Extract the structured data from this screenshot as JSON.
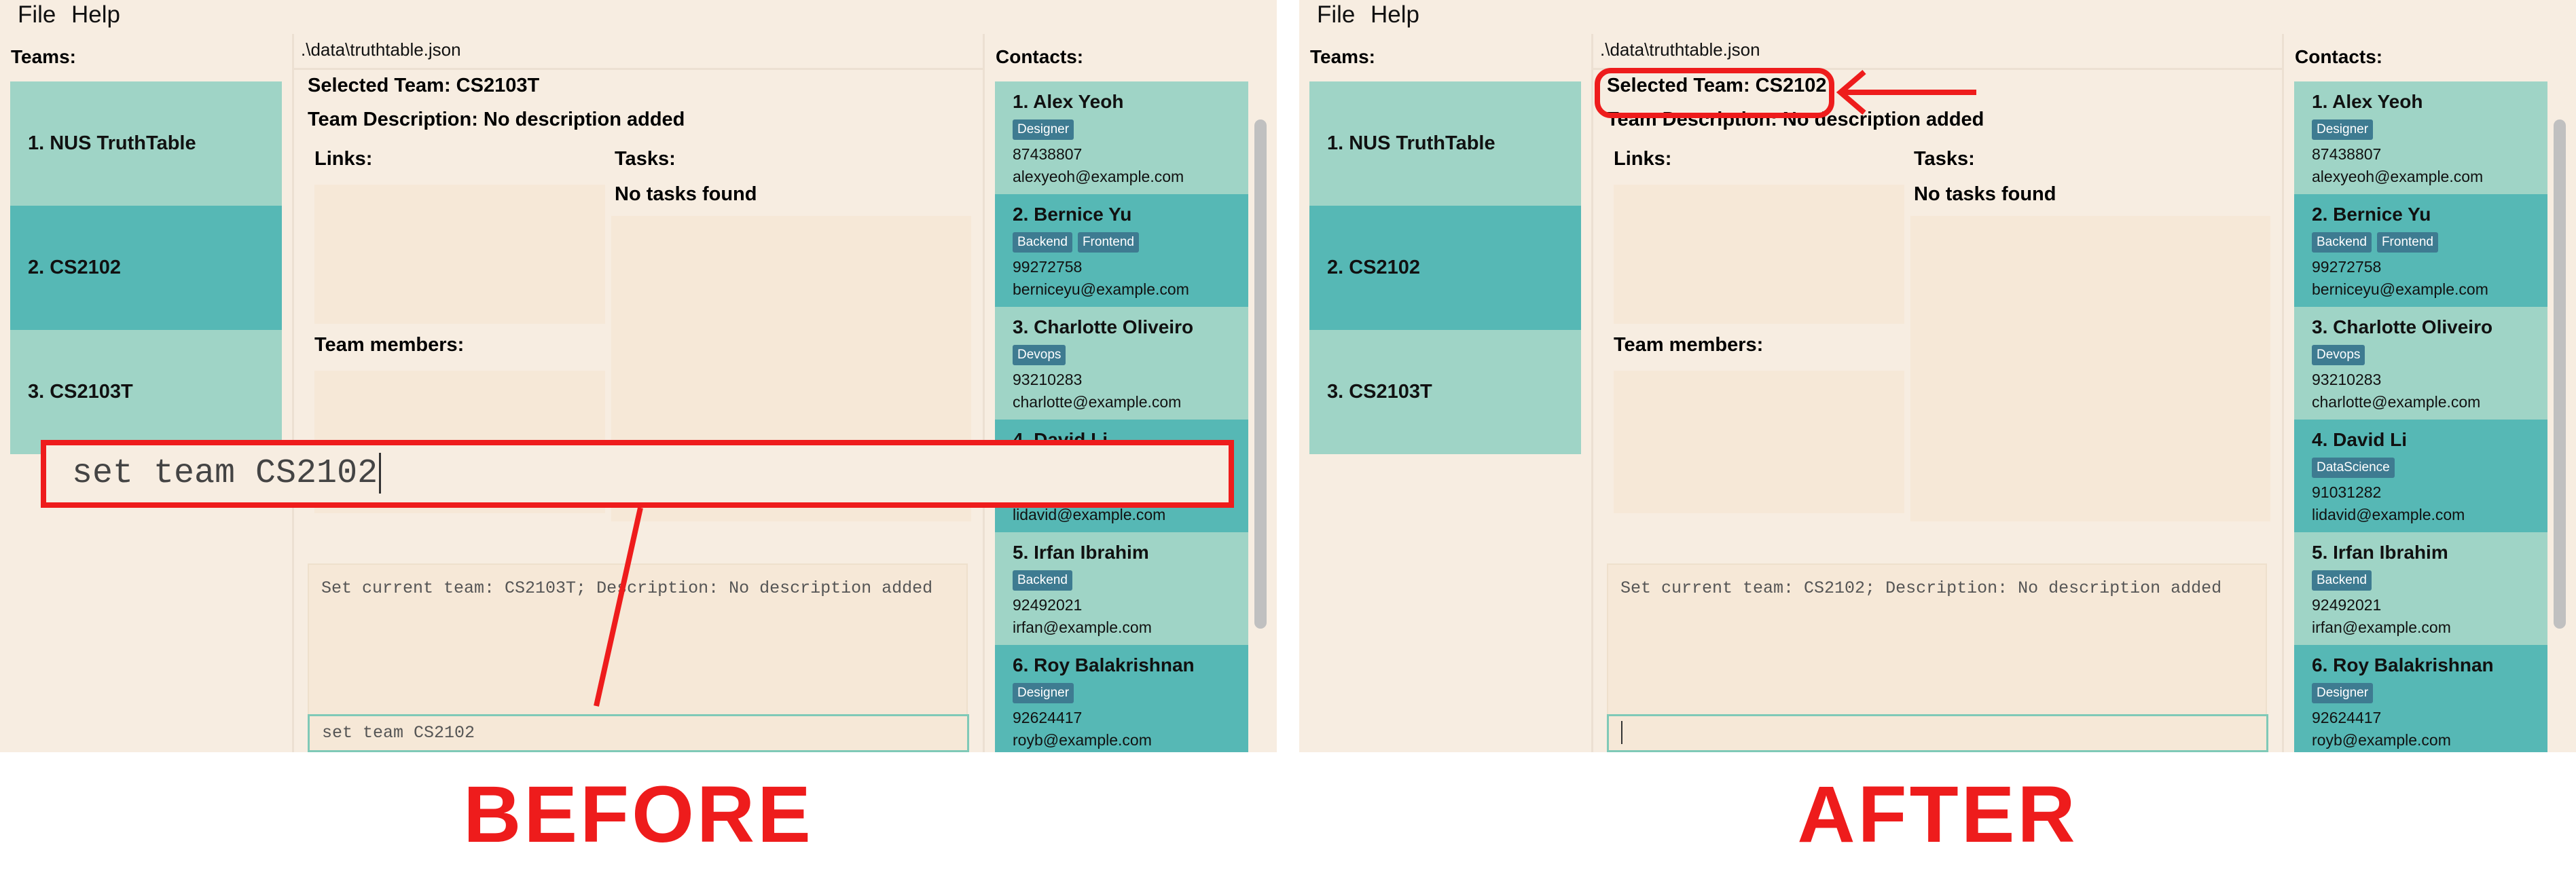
{
  "menu": {
    "file": "File",
    "help": "Help"
  },
  "labels": {
    "teams_title": "Teams:",
    "contacts_title": "Contacts:",
    "file_path": ".\\data\\truthtable.json",
    "links": "Links:",
    "tasks": "Tasks:",
    "team_members": "Team members:",
    "no_tasks": "No tasks found"
  },
  "teams": [
    {
      "label": "1. NUS TruthTable"
    },
    {
      "label": "2. CS2102"
    },
    {
      "label": "3. CS2103T"
    }
  ],
  "contacts": [
    {
      "name": "1. Alex Yeoh",
      "tags": [
        "Designer"
      ],
      "phone": "87438807",
      "email": "alexyeoh@example.com"
    },
    {
      "name": "2. Bernice Yu",
      "tags": [
        "Backend",
        "Frontend"
      ],
      "phone": "99272758",
      "email": "berniceyu@example.com"
    },
    {
      "name": "3. Charlotte Oliveiro",
      "tags": [
        "Devops"
      ],
      "phone": "93210283",
      "email": "charlotte@example.com"
    },
    {
      "name": "4. David Li",
      "tags": [
        "DataScience"
      ],
      "phone": "91031282",
      "email": "lidavid@example.com"
    },
    {
      "name": "5. Irfan Ibrahim",
      "tags": [
        "Backend"
      ],
      "phone": "92492021",
      "email": "irfan@example.com"
    },
    {
      "name": "6. Roy Balakrishnan",
      "tags": [
        "Designer"
      ],
      "phone": "92624417",
      "email": "royb@example.com"
    }
  ],
  "before": {
    "selected_team": "Selected Team: CS2103T",
    "team_description": "Team Description: No description added",
    "result": "Set current team: CS2103T; Description: No description added",
    "command": "set team CS2102"
  },
  "after": {
    "selected_team": "Selected Team: CS2102",
    "team_description": "Team Description: No description added",
    "result": "Set current team: CS2102; Description: No description added",
    "command": ""
  },
  "annotation": {
    "command_zoom": "set team CS2102",
    "before_caption": "BEFORE",
    "after_caption": "AFTER"
  },
  "colors": {
    "window_bg": "#f7ede1",
    "card_light": "#9fd4c6",
    "card_dark": "#56b8b5",
    "tag_bg": "#3e7b91",
    "annotation_red": "#ee1c1c"
  }
}
